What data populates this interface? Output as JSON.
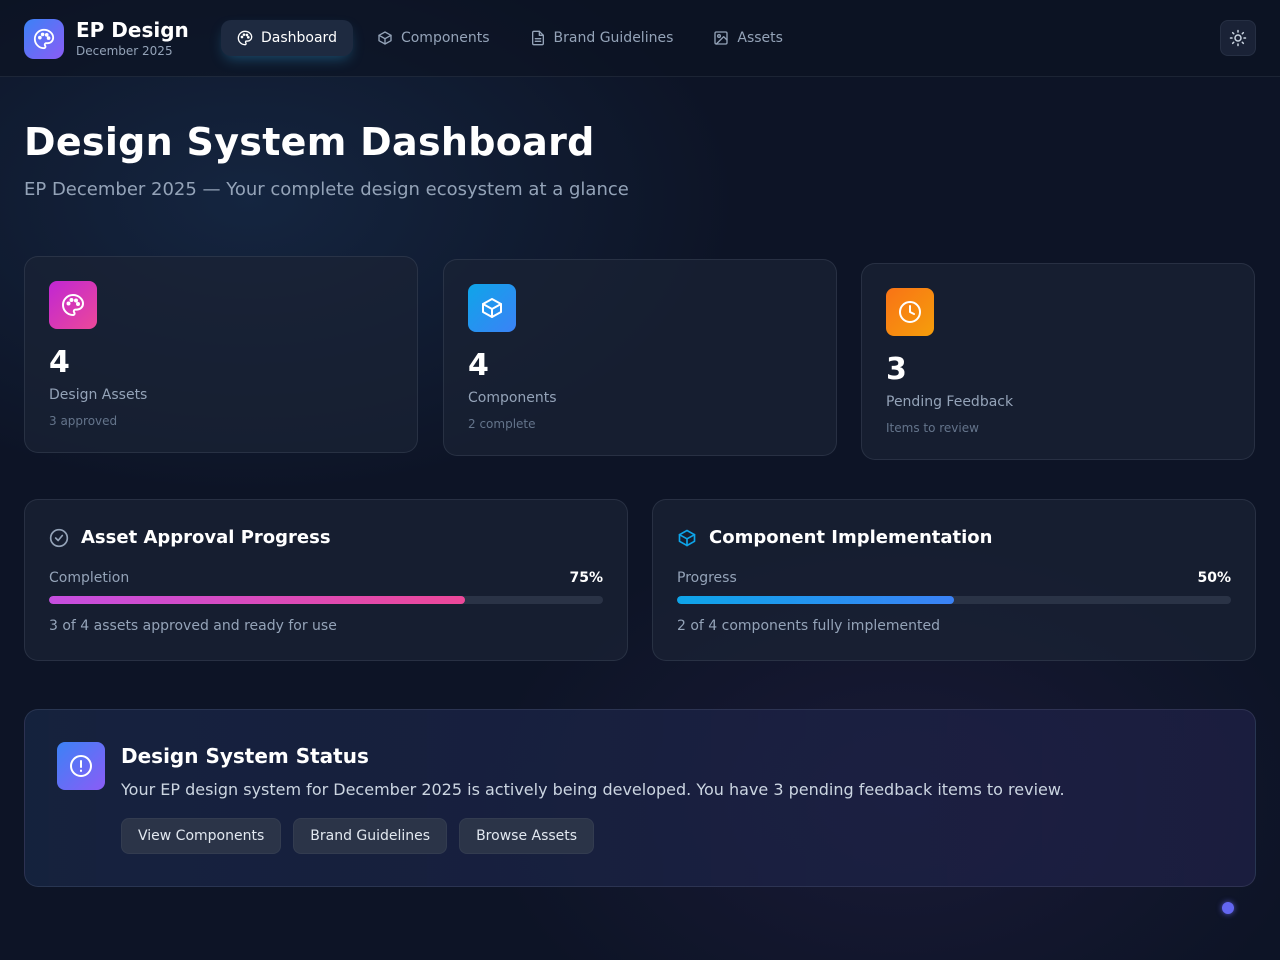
{
  "brand": {
    "title": "EP Design",
    "subtitle": "December 2025"
  },
  "nav": [
    {
      "label": "Dashboard",
      "icon": "palette-icon",
      "active": true
    },
    {
      "label": "Components",
      "icon": "cube-icon"
    },
    {
      "label": "Brand Guidelines",
      "icon": "document-icon"
    },
    {
      "label": "Assets",
      "icon": "image-icon"
    }
  ],
  "theme_toggle_icon": "sun-icon",
  "hero": {
    "title": "Design System Dashboard",
    "subtitle": "EP December 2025 — Your complete design ecosystem at a glance"
  },
  "stats": [
    {
      "value": "4",
      "label": "Design Assets",
      "note": "3 approved",
      "icon": "palette-icon",
      "color": "#d946ef"
    },
    {
      "value": "4",
      "label": "Components",
      "note": "2 complete",
      "icon": "cube-icon",
      "color": "#0ea5e9"
    },
    {
      "value": "3",
      "label": "Pending Feedback",
      "note": "Items to review",
      "icon": "clock-icon",
      "color": "#f97316"
    }
  ],
  "progress": [
    {
      "title": "Asset Approval Progress",
      "icon": "check-circle-icon",
      "label": "Completion",
      "percent_text": "75%",
      "fraction": 0.75,
      "description": "3 of 4 assets approved and ready for use",
      "gradient": [
        "#c54ee0",
        "#ec4899"
      ]
    },
    {
      "title": "Component Implementation",
      "icon": "cube-icon",
      "label": "Progress",
      "percent_text": "50%",
      "fraction": 0.5,
      "description": "2 of 4 components fully implemented",
      "gradient": [
        "#0ea5e9",
        "#3b82f6"
      ]
    }
  ],
  "status": {
    "title": "Design System Status",
    "text": "Your EP design system for December 2025 is actively being developed. You have 3 pending feedback items to review.",
    "icon": "alert-circle-icon",
    "actions": [
      "View Components",
      "Brand Guidelines",
      "Browse Assets"
    ]
  }
}
